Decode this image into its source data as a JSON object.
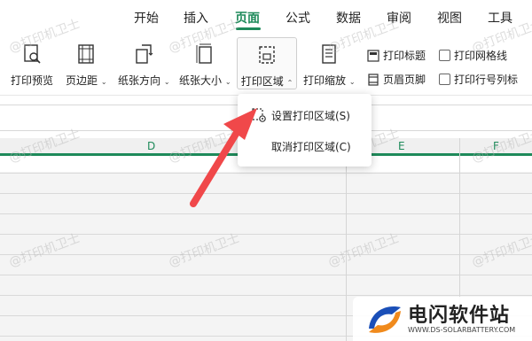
{
  "menu": {
    "tabs": [
      {
        "label": "开始"
      },
      {
        "label": "插入"
      },
      {
        "label": "页面",
        "active": true
      },
      {
        "label": "公式"
      },
      {
        "label": "数据"
      },
      {
        "label": "审阅"
      },
      {
        "label": "视图"
      },
      {
        "label": "工具"
      }
    ]
  },
  "toolbar": {
    "print_preview": "打印预览",
    "margins": "页边距",
    "orientation": "纸张方向",
    "paper_size": "纸张大小",
    "print_area": "打印区域",
    "print_scale": "打印缩放",
    "print_titles": "打印标题",
    "header_footer": "页眉页脚",
    "print_gridlines": "打印网格线",
    "print_row_col_headers": "打印行号列标"
  },
  "grid": {
    "columns": [
      "D",
      "E",
      "F"
    ]
  },
  "dropdown": {
    "set_print_area": "设置打印区域(S)",
    "clear_print_area": "取消打印区域(C)"
  },
  "watermark": "@打印机卫士",
  "logo": {
    "title": "电闪软件站",
    "subtitle": "WWW.DS-SOLARBATTERY.COM"
  },
  "colors": {
    "accent": "#1e8a5a",
    "arrow": "#f0484a",
    "logo_blue": "#1a4fb8",
    "logo_orange": "#f08a1c"
  }
}
